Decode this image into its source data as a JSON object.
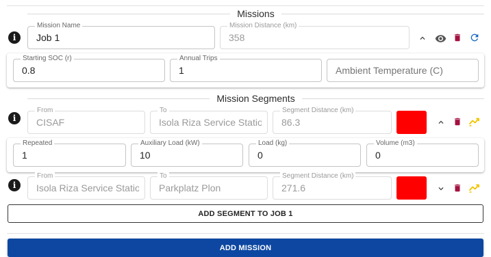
{
  "missions_title": "Missions",
  "mission": {
    "name_label": "Mission Name",
    "name_value": "Job 1",
    "distance_label": "Mission Distance (km)",
    "distance_value": "358",
    "soc_label": "Starting SOC (r)",
    "soc_value": "0.8",
    "trips_label": "Annual Trips",
    "trips_value": "1",
    "temp_placeholder": "Ambient Temperature (C)"
  },
  "segments_title": "Mission Segments",
  "segments": [
    {
      "from_label": "From",
      "from_value": "CISAF",
      "to_label": "To",
      "to_value": "Isola Riza Service Statio",
      "distance_label": "Segment Distance (km)",
      "distance_value": "86.3",
      "color": "#ff0000",
      "repeated_label": "Repeated",
      "repeated_value": "1",
      "aux_label": "Auxiliary Load (kW)",
      "aux_value": "10",
      "load_label": "Load (kg)",
      "load_value": "0",
      "volume_label": "Volume (m3)",
      "volume_value": "0"
    },
    {
      "from_label": "From",
      "from_value": "Isola Riza Service Statio",
      "to_label": "To",
      "to_value": "Parkplatz Plon",
      "distance_label": "Segment Distance (km)",
      "distance_value": "271.6",
      "color": "#ff0000"
    }
  ],
  "buttons": {
    "add_segment": "ADD SEGMENT TO JOB 1",
    "add_mission": "ADD MISSION"
  },
  "colors": {
    "primary": "#0d47a1",
    "delete": "#a3123f",
    "refresh": "#1565c0",
    "route": "#f2c500",
    "swatch": "#ff0000"
  },
  "icons": {
    "info": "info-icon",
    "collapse": "chevron-up-icon",
    "expand": "chevron-down-icon",
    "view": "eye-icon",
    "delete": "trash-icon",
    "refresh": "refresh-icon",
    "route": "route-icon"
  }
}
